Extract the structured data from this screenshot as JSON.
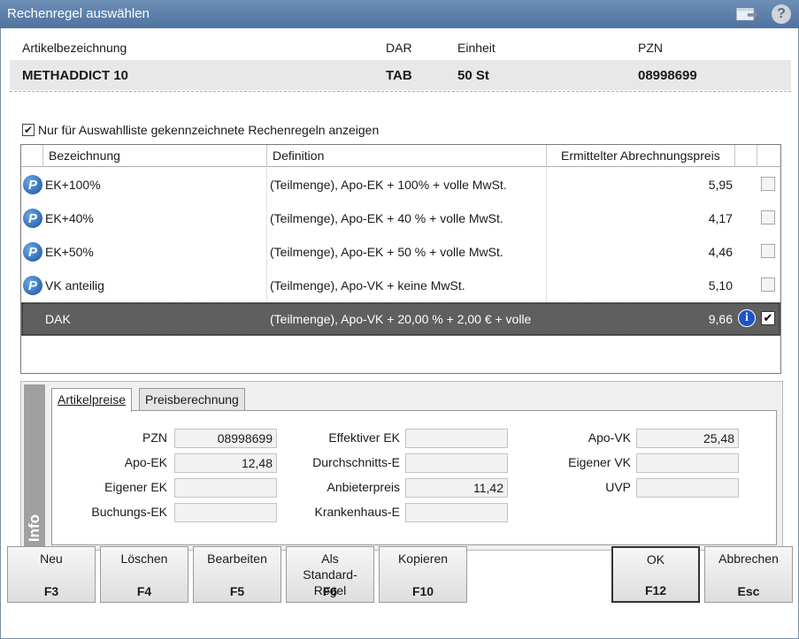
{
  "window": {
    "title": "Rechenregel auswählen"
  },
  "icons": {
    "restore": "window-restore-icon",
    "help": "help-icon",
    "rule": "p-rule-icon",
    "info": "info-icon"
  },
  "article": {
    "labels": {
      "name": "Artikelbezeichnung",
      "dar": "DAR",
      "unit": "Einheit",
      "pzn": "PZN"
    },
    "values": {
      "name": "METHADDICT 10",
      "dar": "TAB",
      "unit": "50 St",
      "pzn": "08998699"
    }
  },
  "filter": {
    "label": "Nur für Auswahlliste gekennzeichnete Rechenregeln anzeigen",
    "checked": true
  },
  "grid": {
    "headers": {
      "name": "Bezeichnung",
      "definition": "Definition",
      "price": "Ermittelter Abrechnungspreis"
    },
    "rows": [
      {
        "name": "EK+100%",
        "definition": "(Teilmenge), Apo-EK + 100% + volle MwSt.",
        "price": "5,95",
        "icon": true,
        "selected": false
      },
      {
        "name": "EK+40%",
        "definition": "(Teilmenge), Apo-EK + 40 % + volle MwSt.",
        "price": "4,17",
        "icon": true,
        "selected": false
      },
      {
        "name": "EK+50%",
        "definition": "(Teilmenge), Apo-EK + 50 % + volle MwSt.",
        "price": "4,46",
        "icon": true,
        "selected": false
      },
      {
        "name": "VK anteilig",
        "definition": "(Teilmenge), Apo-VK + keine MwSt.",
        "price": "5,10",
        "icon": true,
        "selected": false
      },
      {
        "name": "DAK",
        "definition": "(Teilmenge), Apo-VK + 20,00 % + 2,00 € + volle",
        "price": "9,66",
        "icon": false,
        "selected": true
      }
    ]
  },
  "info": {
    "side_label": "Info",
    "tabs": {
      "prices": "Artikelpreise",
      "calc": "Preisberechnung"
    },
    "fields": {
      "pzn": {
        "label": "PZN",
        "value": "08998699"
      },
      "apo_ek": {
        "label": "Apo-EK",
        "value": "12,48"
      },
      "eigener_ek": {
        "label": "Eigener EK",
        "value": ""
      },
      "buchungs_ek": {
        "label": "Buchungs-EK",
        "value": ""
      },
      "effektiver_ek": {
        "label": "Effektiver EK",
        "value": ""
      },
      "durchschnitts_e": {
        "label": "Durchschnitts-E",
        "value": ""
      },
      "anbieterpreis": {
        "label": "Anbieterpreis",
        "value": "11,42"
      },
      "krankenhaus_e": {
        "label": "Krankenhaus-E",
        "value": ""
      },
      "apo_vk": {
        "label": "Apo-VK",
        "value": "25,48"
      },
      "eigener_vk": {
        "label": "Eigener VK",
        "value": ""
      },
      "uvp": {
        "label": "UVP",
        "value": ""
      }
    }
  },
  "buttons": {
    "new": {
      "label": "Neu",
      "key": "F3"
    },
    "delete": {
      "label": "Löschen",
      "key": "F4"
    },
    "edit": {
      "label": "Bearbeiten",
      "key": "F5"
    },
    "standard": {
      "label": "Als Standard-Regel",
      "key": "F6"
    },
    "copy": {
      "label": "Kopieren",
      "key": "F10"
    },
    "ok": {
      "label": "OK",
      "key": "F12"
    },
    "cancel": {
      "label": "Abbrechen",
      "key": "Esc"
    }
  }
}
